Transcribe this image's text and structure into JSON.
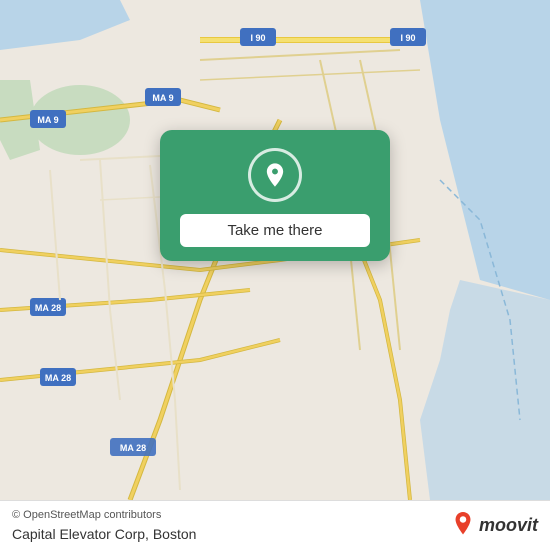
{
  "map": {
    "background_color": "#e8ddd0",
    "attribution": "© OpenStreetMap contributors"
  },
  "card": {
    "button_label": "Take me there",
    "pin_icon": "location-pin"
  },
  "bottom_bar": {
    "copyright": "© OpenStreetMap contributors",
    "location_name": "Capital Elevator Corp, Boston",
    "brand": "moovit"
  },
  "roads": {
    "accent_color": "#f0d060",
    "highway_color": "#f5e070",
    "water_color": "#b8d8e8",
    "green_color": "#c8dcc0"
  }
}
